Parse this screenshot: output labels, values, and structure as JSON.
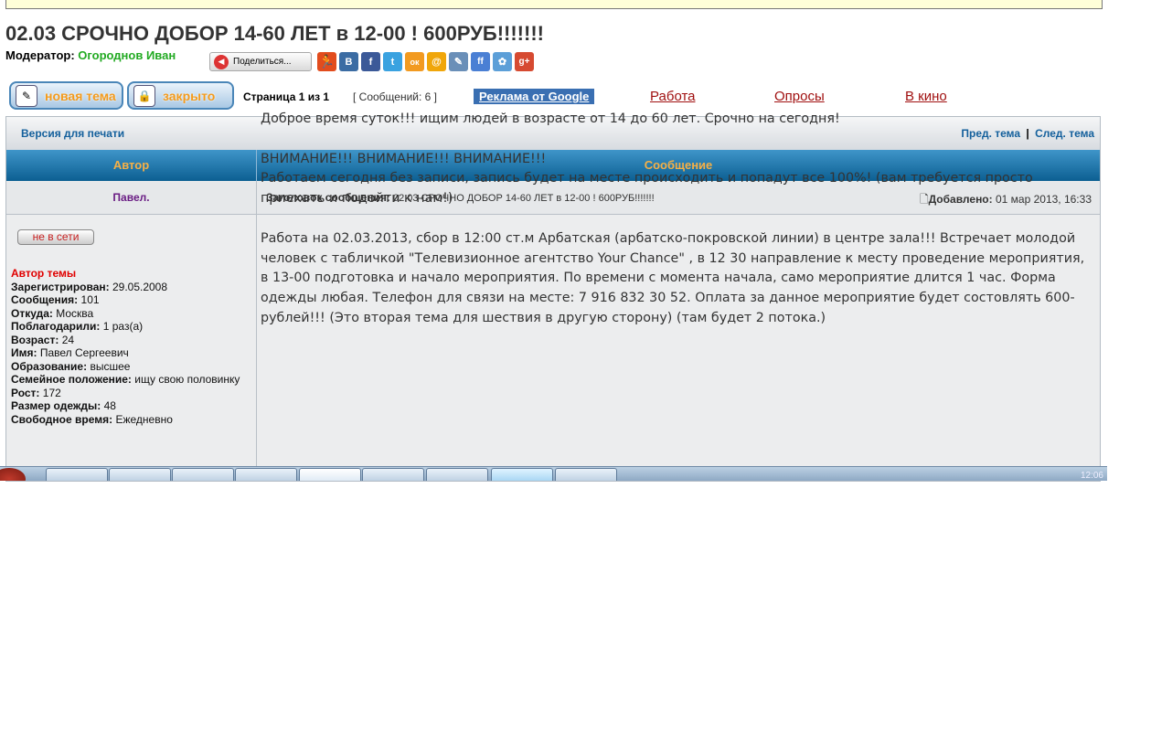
{
  "topic": {
    "title": "02.03 СРОЧНО ДОБОР 14-60 ЛЕТ в 12-00 ! 600РУБ!!!!!!!",
    "moderator_label": "Модератор:",
    "moderator_name": "Огороднов Иван"
  },
  "share": {
    "label": "Поделиться...",
    "socials": [
      {
        "name": "vkontakte",
        "glyph": "В",
        "color": "#3b6ca3"
      },
      {
        "name": "facebook",
        "glyph": "f",
        "color": "#3b5998"
      },
      {
        "name": "twitter",
        "glyph": "t",
        "color": "#3aa2e0"
      },
      {
        "name": "odnoklassniki",
        "glyph": "ок",
        "color": "#f29a20"
      },
      {
        "name": "mail",
        "glyph": "@",
        "color": "#f0a60a"
      },
      {
        "name": "livejournal",
        "glyph": "✎",
        "color": "#6a8fb8"
      },
      {
        "name": "friendfeed",
        "glyph": "ff",
        "color": "#4a7fd4"
      },
      {
        "name": "moikrug",
        "glyph": "✿",
        "color": "#5c9fd8"
      },
      {
        "name": "google-plus",
        "glyph": "g+",
        "color": "#d64a31"
      }
    ]
  },
  "toolbar": {
    "new_topic": "новая тема",
    "closed": "закрыто",
    "page_info": "Страница 1 из 1",
    "messages_count": "[ Сообщений: 6 ]",
    "google_ads": "Реклама от Google",
    "links": [
      "Работа",
      "Опросы",
      "В кино"
    ]
  },
  "nav": {
    "print_version": "Версия для печати",
    "prev_topic": "Пред. тема",
    "separator": "|",
    "next_topic": "След. тема"
  },
  "table": {
    "col_author": "Автор",
    "col_message": "Сообщение"
  },
  "post": {
    "author": "Павел.",
    "subject_label": "Заголовок сообщения:",
    "subject": "02.03 СРОЧНО ДОБОР 14-60 ЛЕТ в 12-00 ! 600РУБ!!!!!!!",
    "added_label": "Добавлено:",
    "added_date": "01 мар 2013, 16:33",
    "status": "не в сети",
    "topic_starter": "Автор темы",
    "profile": [
      {
        "label": "Зарегистрирован:",
        "value": "29.05.2008"
      },
      {
        "label": "Сообщения:",
        "value": "101"
      },
      {
        "label": "Откуда:",
        "value": "Москва"
      },
      {
        "label": "Поблагодарили:",
        "value": "1 раз(а)"
      },
      {
        "label": "Возраст:",
        "value": "24"
      },
      {
        "label": "Имя:",
        "value": "Павел Сергеевич"
      },
      {
        "label": "Образование:",
        "value": "высшее"
      },
      {
        "label": "Семейное положение:",
        "value": "ищу свою половинку"
      },
      {
        "label": "Рост:",
        "value": "172"
      },
      {
        "label": "Размер одежды:",
        "value": "48"
      },
      {
        "label": "Свободное время:",
        "value": "Ежедневно"
      }
    ],
    "body": {
      "p1": "Доброе время суток!!! ищим людей в возрасте от 14 до 60 лет. Срочно на сегодня!",
      "p2_line1": "ВНИМАНИЕ!!! ВНИМАНИЕ!!! ВНИМАНИЕ!!!",
      "p2_line2": "Работаем сегодня без записи, запись будет на месте происходить и попадут все 100%! (вам требуется просто приехать и подойти к нам!)",
      "p3": "Работа на 02.03.2013, сбор в 12:00 ст.м Арбатская (арбатско-покровской линии) в центре зала!!! Встречает молодой человек с табличкой \"Телевизионное агентство Your Chance\" , в 12 30 направление к месту проведение мероприятия, в 13-00 подготовка и начало мероприятия. По времени с момента начала, само мероприятие длится 1 час. Форма одежды любая. Телефон для связи на месте: 7 916 832 30 52. Оплата за данное мероприятие будет состовлять 600-рублей!!! (Это вторая тема для шествия в другую сторону) (там будет 2 потока.)"
    }
  },
  "taskbar": {
    "clock": "12:06"
  }
}
